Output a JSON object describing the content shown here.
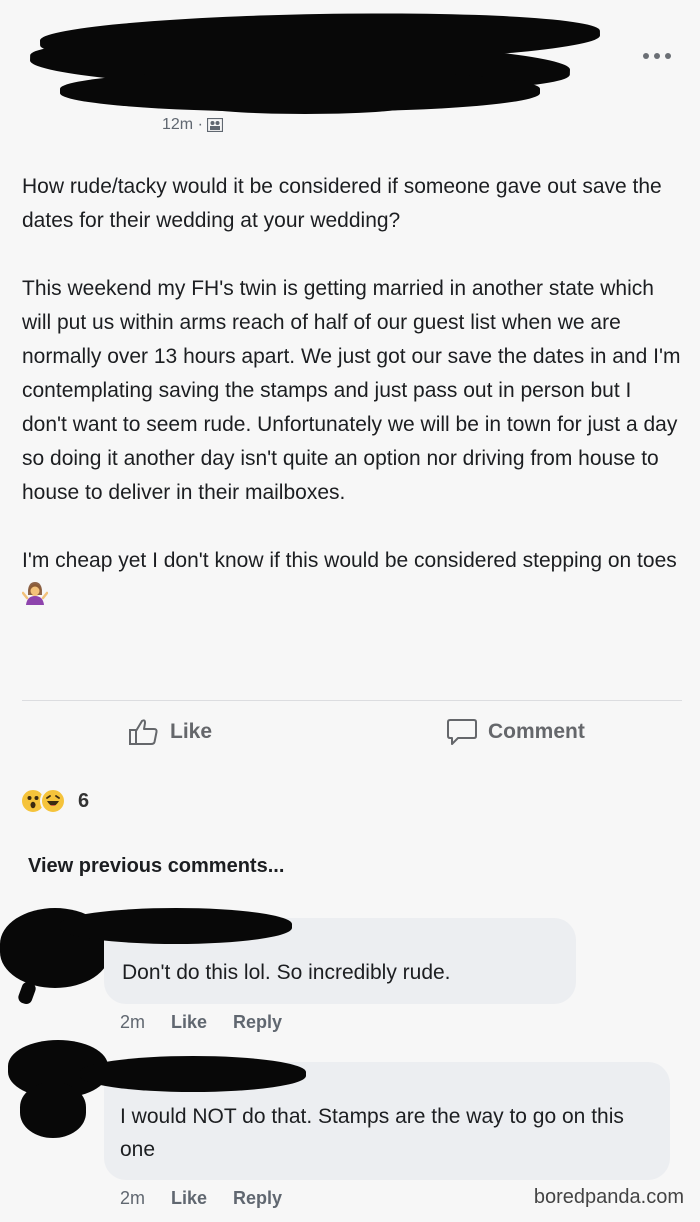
{
  "post": {
    "timestamp": "12m ·",
    "paragraphs": [
      "How rude/tacky would it be considered if someone gave out save the dates for their wedding at your wedding?",
      "This weekend my FH's twin is getting married in another state which will put us within arms reach of half of our guest list when we are normally over 13 hours apart. We just got our save the dates in and I'm contemplating saving the stamps and just pass out in person but I don't want to seem rude. Unfortunately we will be in town for just a day so doing it another day isn't quite an option nor driving from house to house to deliver in their mailboxes.",
      "I'm cheap yet I don't know if this would be considered stepping on toes"
    ],
    "icons": {
      "more": "more-options-icon",
      "privacy": "friends-privacy-icon",
      "emoji": "woman-shrugging-emoji"
    }
  },
  "actions": {
    "like_label": "Like",
    "comment_label": "Comment"
  },
  "reactions": {
    "count": "6",
    "icons": [
      "wow-reaction-icon",
      "haha-reaction-icon"
    ]
  },
  "comments": {
    "view_previous_label": "View previous comments...",
    "items": [
      {
        "text": "Don't do this lol. So incredibly rude.",
        "time": "2m",
        "like": "Like",
        "reply": "Reply"
      },
      {
        "text": "I would NOT do that. Stamps are the way to go on this one",
        "time": "2m",
        "like": "Like",
        "reply": "Reply"
      }
    ]
  },
  "watermark": "boredpanda.com",
  "colors": {
    "background": "#f7f7f7",
    "redaction": "#080808",
    "action_gray": "#65676b",
    "bubble": "#eceef1"
  }
}
